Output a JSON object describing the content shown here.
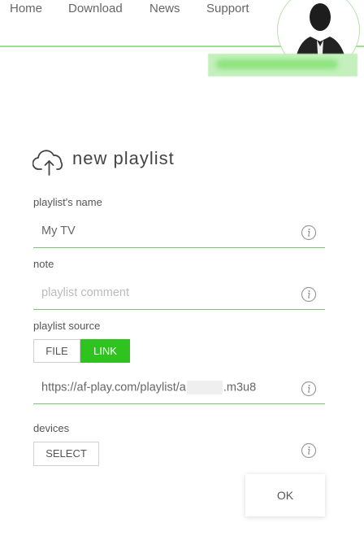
{
  "nav": {
    "items": [
      "Home",
      "Download",
      "News",
      "Support"
    ]
  },
  "form": {
    "title": "new playlist",
    "name": {
      "label": "playlist's name",
      "value": "My TV"
    },
    "note": {
      "label": "note",
      "placeholder": "playlist comment"
    },
    "source": {
      "label": "playlist source",
      "options": [
        "FILE",
        "LINK"
      ],
      "selected": "LINK"
    },
    "url": {
      "prefix": "https://af-play.com/playlist/a",
      "suffix": ".m3u8"
    },
    "devices": {
      "label": "devices",
      "button": "SELECT"
    },
    "ok_label": "OK"
  },
  "colors": {
    "accent": "#2ec31e",
    "underline": "#7cc47a",
    "nav_line": "#9be08f"
  },
  "icons": {
    "upload": "cloud-upload-icon",
    "info": "info-icon",
    "avatar": "person-silhouette"
  }
}
